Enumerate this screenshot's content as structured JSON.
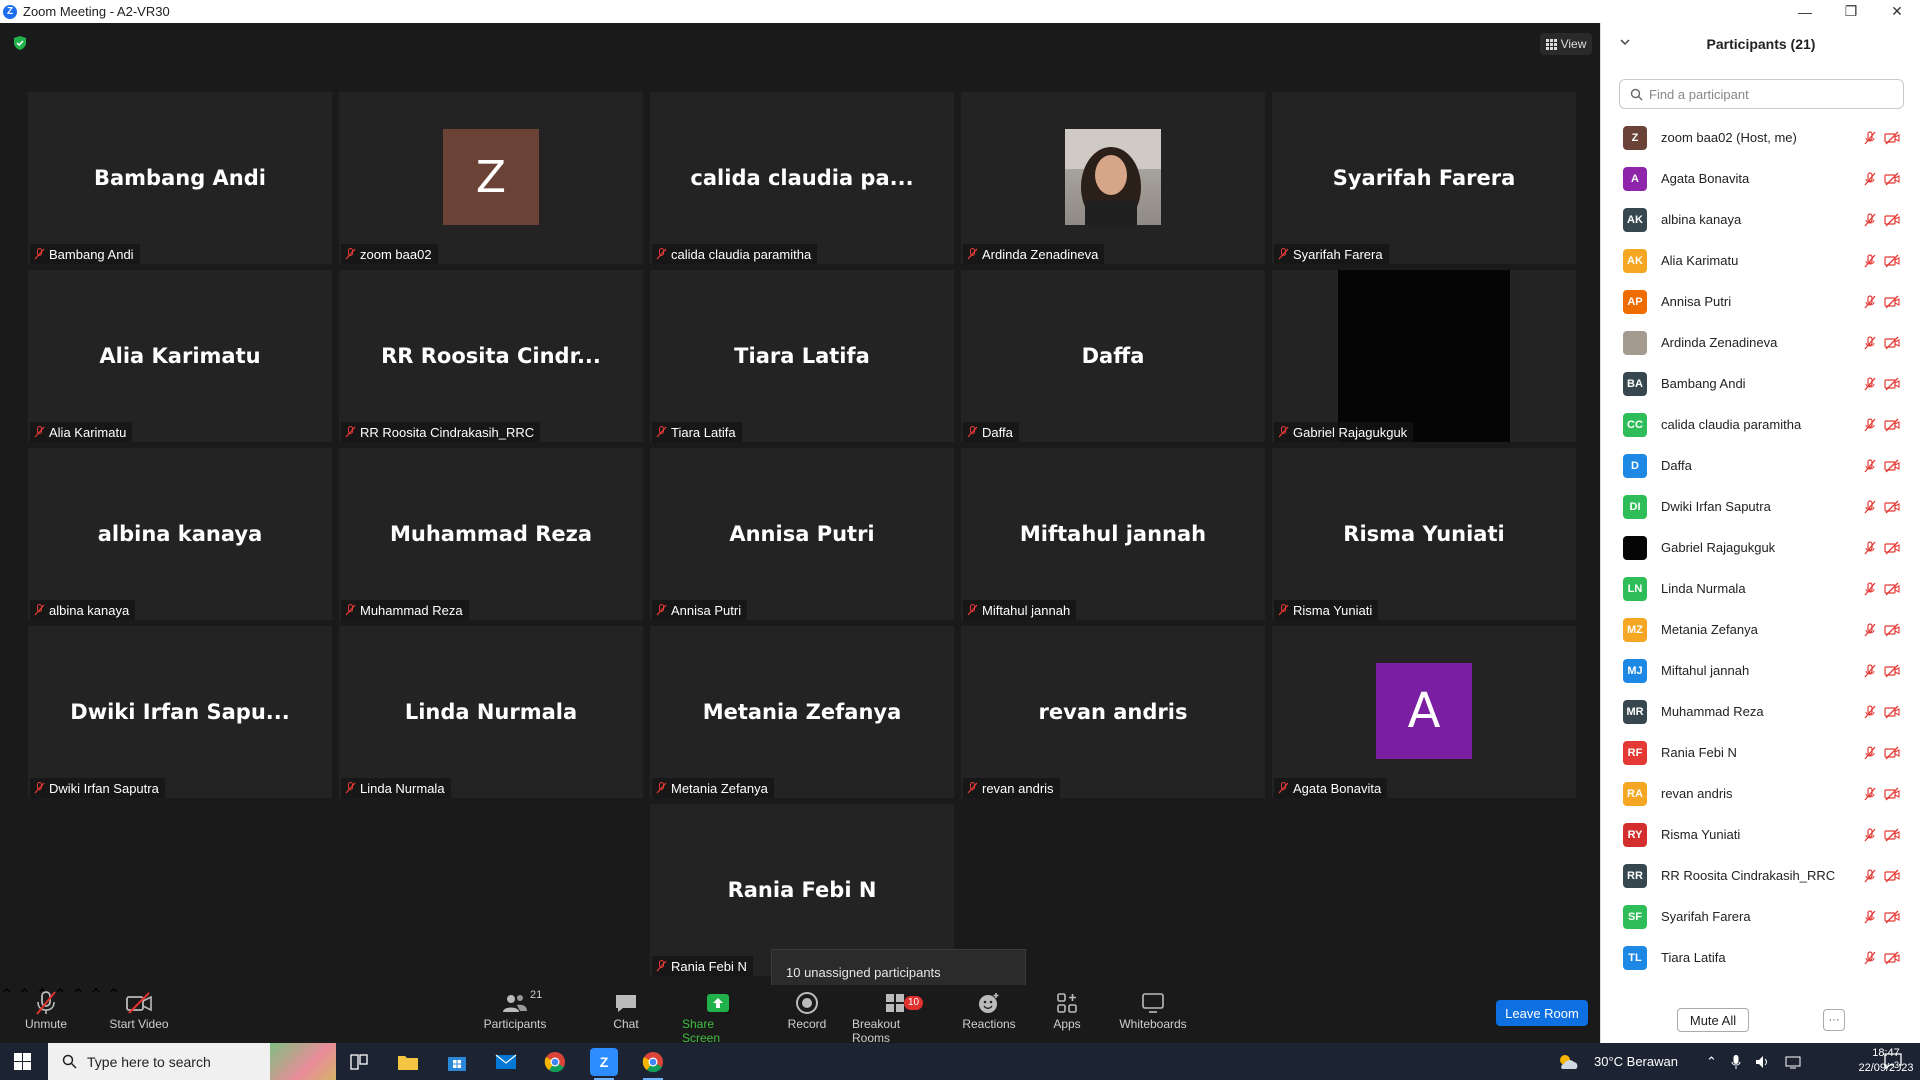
{
  "window": {
    "title": "Zoom Meeting - A2-VR30",
    "logo": "Z"
  },
  "meeting": {
    "view_label": "View"
  },
  "tiles": [
    {
      "big": "Bambang Andi",
      "label": "Bambang Andi"
    },
    {
      "big": "Z",
      "label": "zoom baa02"
    },
    {
      "big": "calida claudia pa...",
      "label": "calida claudia paramitha"
    },
    {
      "big": "",
      "label": "Ardinda Zenadineva"
    },
    {
      "big": "Syarifah Farera",
      "label": "Syarifah Farera"
    },
    {
      "big": "Alia Karimatu",
      "label": "Alia Karimatu"
    },
    {
      "big": "RR Roosita Cindr...",
      "label": "RR Roosita Cindrakasih_RRC"
    },
    {
      "big": "Tiara Latifa",
      "label": "Tiara Latifa"
    },
    {
      "big": "Daffa",
      "label": "Daffa"
    },
    {
      "big": "",
      "label": "Gabriel Rajagukguk"
    },
    {
      "big": "albina kanaya",
      "label": "albina kanaya"
    },
    {
      "big": "Muhammad Reza",
      "label": "Muhammad Reza"
    },
    {
      "big": "Annisa Putri",
      "label": "Annisa Putri"
    },
    {
      "big": "Miftahul jannah",
      "label": "Miftahul jannah"
    },
    {
      "big": "Risma Yuniati",
      "label": "Risma Yuniati"
    },
    {
      "big": "Dwiki Irfan Sapu...",
      "label": "Dwiki Irfan Saputra"
    },
    {
      "big": "Linda Nurmala",
      "label": "Linda Nurmala"
    },
    {
      "big": "Metania Zefanya",
      "label": "Metania Zefanya"
    },
    {
      "big": "revan andris",
      "label": "revan andris"
    },
    {
      "big": "A",
      "label": "Agata Bonavita"
    },
    {
      "big": "Rania Febi N",
      "label": "Rania Febi N"
    }
  ],
  "tooltip": {
    "text": "10 unassigned participants"
  },
  "toolbar": {
    "unmute": "Unmute",
    "start_video": "Start Video",
    "participants": "Participants",
    "participants_count": "21",
    "chat": "Chat",
    "share_screen": "Share Screen",
    "record": "Record",
    "breakout_rooms": "Breakout Rooms",
    "breakout_badge": "10",
    "reactions": "Reactions",
    "apps": "Apps",
    "whiteboards": "Whiteboards",
    "leave_room": "Leave Room"
  },
  "panel": {
    "title": "Participants (21)",
    "search_placeholder": "Find a participant",
    "mute_all": "Mute All",
    "more": "···",
    "participants": [
      {
        "initials": "Z",
        "name": "zoom baa02 (Host, me)",
        "color": "#6b4336"
      },
      {
        "initials": "A",
        "name": "Agata Bonavita",
        "color": "#8e24aa"
      },
      {
        "initials": "AK",
        "name": "albina kanaya",
        "color": "#37474f"
      },
      {
        "initials": "AK",
        "name": "Alia Karimatu",
        "color": "#f5a623"
      },
      {
        "initials": "AP",
        "name": "Annisa Putri",
        "color": "#ef6c00"
      },
      {
        "initials": "",
        "name": "Ardinda Zenadineva",
        "color": "#a59a8f"
      },
      {
        "initials": "BA",
        "name": "Bambang Andi",
        "color": "#37474f"
      },
      {
        "initials": "CC",
        "name": "calida claudia paramitha",
        "color": "#2ebd59"
      },
      {
        "initials": "D",
        "name": "Daffa",
        "color": "#1e88e5"
      },
      {
        "initials": "DI",
        "name": "Dwiki Irfan Saputra",
        "color": "#2ebd59"
      },
      {
        "initials": "",
        "name": "Gabriel Rajagukguk",
        "color": "#050505"
      },
      {
        "initials": "LN",
        "name": "Linda Nurmala",
        "color": "#2ebd59"
      },
      {
        "initials": "MZ",
        "name": "Metania Zefanya",
        "color": "#f5a623"
      },
      {
        "initials": "MJ",
        "name": "Miftahul jannah",
        "color": "#1e88e5"
      },
      {
        "initials": "MR",
        "name": "Muhammad Reza",
        "color": "#37474f"
      },
      {
        "initials": "RF",
        "name": "Rania Febi N",
        "color": "#e53935"
      },
      {
        "initials": "RA",
        "name": "revan andris",
        "color": "#f5a623"
      },
      {
        "initials": "RY",
        "name": "Risma Yuniati",
        "color": "#d32f2f"
      },
      {
        "initials": "RR",
        "name": "RR Roosita Cindrakasih_RRC",
        "color": "#37474f"
      },
      {
        "initials": "SF",
        "name": "Syarifah Farera",
        "color": "#2ebd59"
      },
      {
        "initials": "TL",
        "name": "Tiara Latifa",
        "color": "#1e88e5"
      }
    ]
  },
  "taskbar": {
    "search_placeholder": "Type here to search",
    "weather": "30°C  Berawan",
    "time": "18:47",
    "date": "22/09/2023",
    "notif_count": "3"
  },
  "colors": {
    "accent_blue": "#0e6fe1",
    "share_green": "#3fbf3f",
    "muted_red": "#e0312f"
  }
}
